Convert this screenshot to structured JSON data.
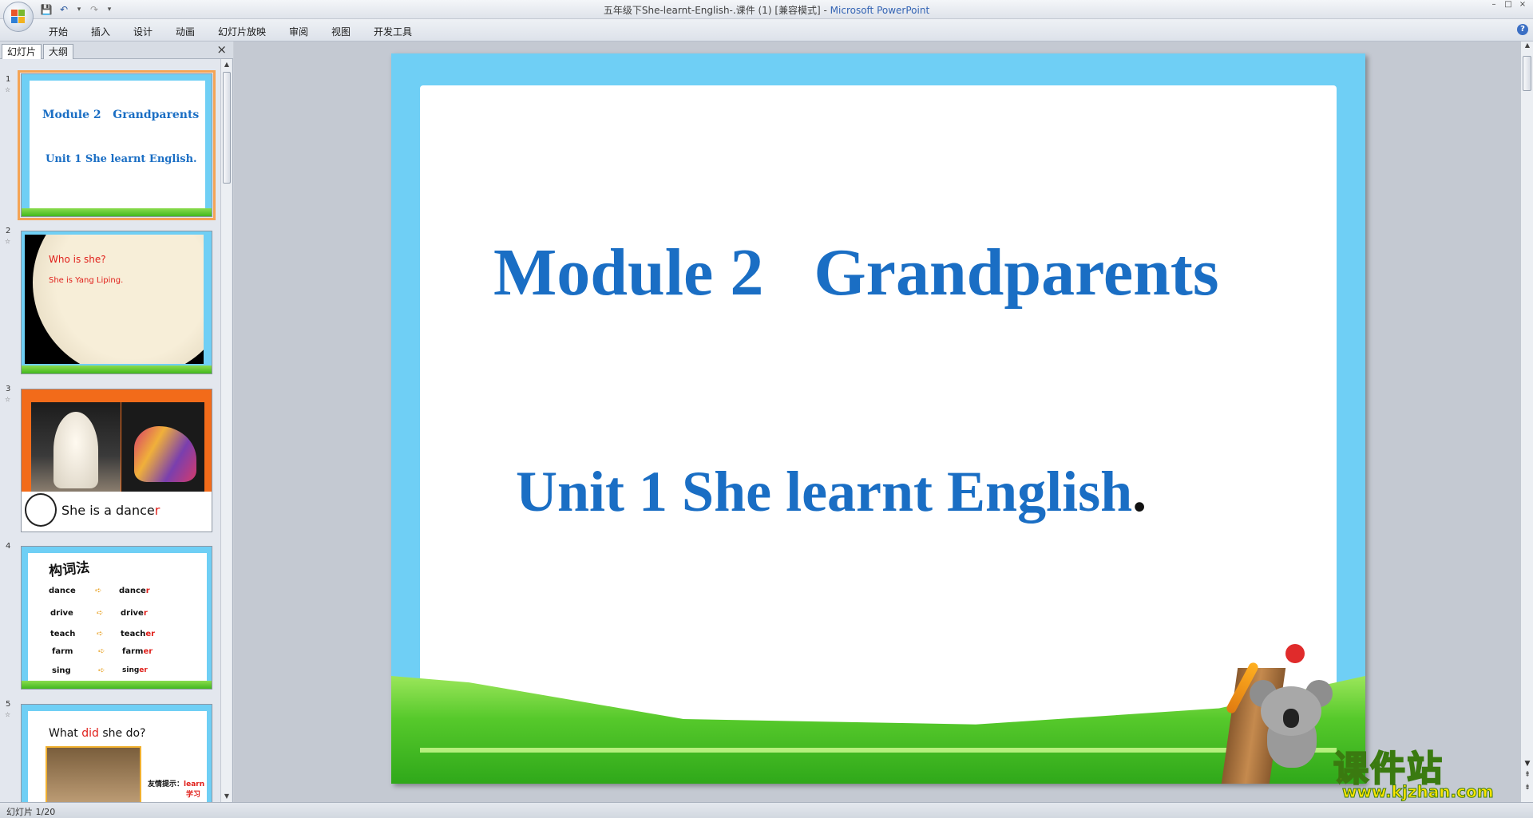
{
  "window": {
    "title_doc": "五年级下She-learnt-English-.课件 (1) [兼容模式]",
    "title_sep": " - ",
    "title_app": "Microsoft PowerPoint",
    "min": "–",
    "max": "□",
    "close": "×"
  },
  "qat": {
    "save": "💾",
    "undo": "↶",
    "undo_arrow": "▾",
    "redo": "↷",
    "customize": "▾"
  },
  "ribbon_tabs": [
    "开始",
    "插入",
    "设计",
    "动画",
    "幻灯片放映",
    "审阅",
    "视图",
    "开发工具"
  ],
  "help": "?",
  "pane": {
    "tab_slides": "幻灯片",
    "tab_outline": "大纲",
    "close": "×"
  },
  "thumbnails": [
    {
      "num": "1",
      "line1": "Module 2   Grandparents",
      "line2": "Unit 1 She learnt English."
    },
    {
      "num": "2",
      "question": "Who is she?",
      "answer": "She is Yang Liping."
    },
    {
      "num": "3",
      "caption_main": "She is a dance",
      "caption_red": "r"
    },
    {
      "num": "4",
      "heading": "构词法",
      "words": [
        {
          "base": "dance",
          "stem": "dance",
          "suffix": "r"
        },
        {
          "base": "drive",
          "stem": "drive",
          "suffix": "r"
        },
        {
          "base": "teach",
          "stem": "teach",
          "suffix": "er"
        },
        {
          "base": "farm",
          "stem": "farm",
          "suffix": "er"
        },
        {
          "base": "sing",
          "stem": "sing",
          "suffix": "er"
        }
      ]
    },
    {
      "num": "5",
      "q_pre": "What ",
      "q_red": "did",
      "q_post": " she do?",
      "hint_label": "友情提示：",
      "hint_word": "learn",
      "hint_cn": "学习"
    }
  ],
  "slide": {
    "title": "Module 2   Grandparents",
    "subtitle": "Unit 1 She learnt English",
    "subtitle_dot": "."
  },
  "watermark": {
    "cn": "课件站",
    "url": "www.kjzhan.com"
  },
  "status": {
    "slide_pos": "幻灯片 1/20"
  },
  "colors": {
    "accent_blue": "#1a6ec4",
    "frame_blue": "#6fcff5",
    "grass_green": "#42b81f",
    "red_text": "#e0201b"
  }
}
